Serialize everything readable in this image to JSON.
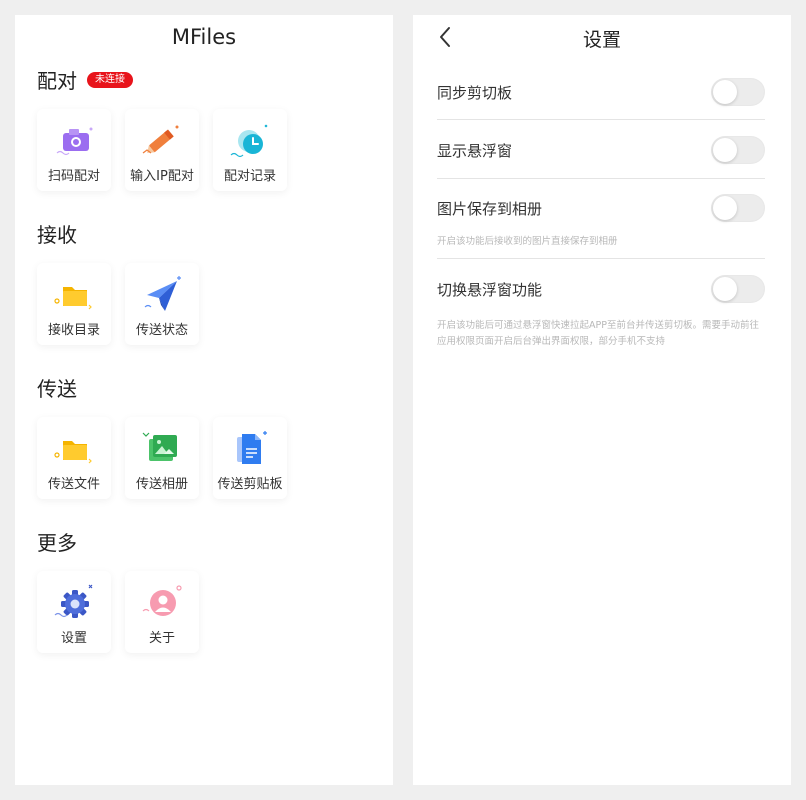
{
  "home": {
    "app_title": "MFiles",
    "sections": [
      {
        "title": "配对",
        "badge": "未连接",
        "items": [
          {
            "label": "扫码配对",
            "icon": "scan-camera-icon"
          },
          {
            "label": "输入IP配对",
            "icon": "pencil-icon"
          },
          {
            "label": "配对记录",
            "icon": "clock-icon"
          }
        ]
      },
      {
        "title": "接收",
        "items": [
          {
            "label": "接收目录",
            "icon": "folder-icon"
          },
          {
            "label": "传送状态",
            "icon": "paper-plane-icon"
          }
        ]
      },
      {
        "title": "传送",
        "items": [
          {
            "label": "传送文件",
            "icon": "folder-icon"
          },
          {
            "label": "传送相册",
            "icon": "image-icon"
          },
          {
            "label": "传送剪贴板",
            "icon": "document-icon"
          }
        ]
      },
      {
        "title": "更多",
        "items": [
          {
            "label": "设置",
            "icon": "gear-icon"
          },
          {
            "label": "关于",
            "icon": "user-icon"
          }
        ]
      }
    ]
  },
  "settings": {
    "title": "设置",
    "back_icon": "chevron-left-icon",
    "rows": [
      {
        "label": "同步剪切板",
        "enabled": false
      },
      {
        "label": "显示悬浮窗",
        "enabled": false
      },
      {
        "label": "图片保存到相册",
        "enabled": false,
        "description": "开启该功能后接收到的图片直接保存到相册"
      },
      {
        "label": "切换悬浮窗功能",
        "enabled": false,
        "description": "开启该功能后可通过悬浮窗快速拉起APP至前台并传送剪切板。需要手动前往应用权限页面开启后台弹出界面权限，部分手机不支持"
      }
    ]
  },
  "colors": {
    "badge": "#e8141b",
    "toggle_off": "#ececec"
  }
}
